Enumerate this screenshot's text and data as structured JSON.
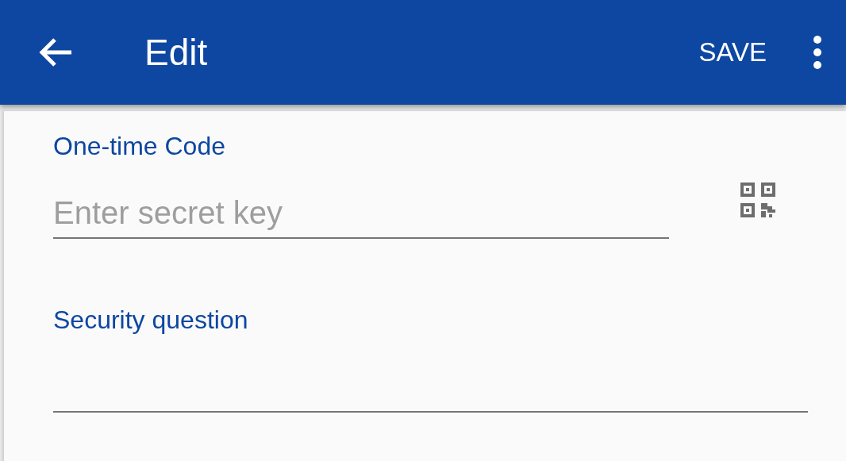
{
  "app_bar": {
    "title": "Edit",
    "action": "SAVE"
  },
  "fields": [
    {
      "kind": "scan",
      "label": "One-time Code",
      "placeholder": "Enter secret key"
    },
    {
      "kind": "plain",
      "label": "Security question"
    }
  ]
}
